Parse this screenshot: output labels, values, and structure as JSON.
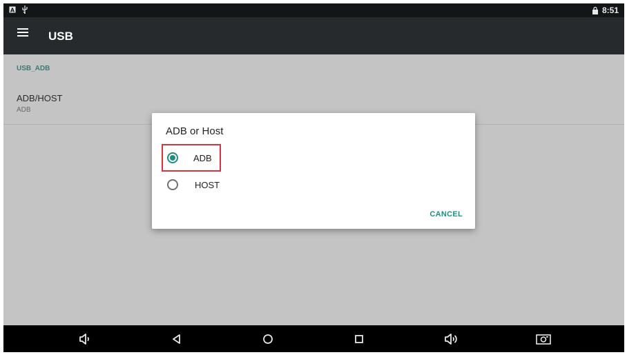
{
  "status_bar": {
    "time": "8:51",
    "icons": [
      "notification-a-icon",
      "usb-icon",
      "battery-lock-icon"
    ]
  },
  "app_bar": {
    "title": "USB",
    "menu_icon": "hamburger-menu-icon"
  },
  "settings": {
    "section_header": "USB_ADB",
    "item": {
      "title": "ADB/HOST",
      "summary": "ADB"
    }
  },
  "dialog": {
    "title": "ADB or Host",
    "options": [
      {
        "label": "ADB",
        "selected": true
      },
      {
        "label": "HOST",
        "selected": false
      }
    ],
    "cancel_label": "CANCEL"
  },
  "nav_bar": {
    "buttons": [
      "volume-down-icon",
      "back-icon",
      "home-icon",
      "recents-icon",
      "volume-up-icon",
      "screenshot-icon"
    ]
  },
  "colors": {
    "accent": "#1f8d82",
    "highlight_border": "#d8323a",
    "app_bar": "#262a2c",
    "status_bar": "#131617"
  }
}
